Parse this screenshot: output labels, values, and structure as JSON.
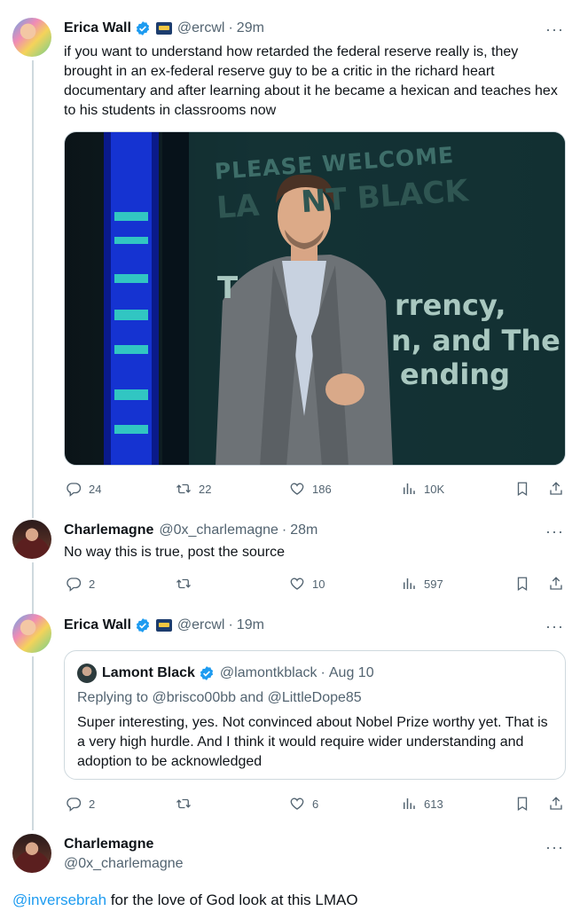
{
  "tweets": [
    {
      "name": "Erica Wall",
      "handle": "@ercwl",
      "time": "29m",
      "text": "if you want to understand how retarded the federal reserve really is, they brought in an ex-federal reserve guy to be a critic in the richard heart documentary and after learning about it he became a hexican and teaches hex to his students in classrooms now",
      "image": {
        "line1": "PLEASE WELCOME",
        "line2": "LA    NT BLACK",
        "line3": "rrency,",
        "line4": "n, and The",
        "line5": "ending",
        "line3_prefix": "T"
      },
      "stats": {
        "replies": "24",
        "retweets": "22",
        "likes": "186",
        "views": "10K"
      }
    },
    {
      "name": "Charlemagne",
      "handle": "@0x_charlemagne",
      "time": "28m",
      "text": "No way this is true, post the source",
      "stats": {
        "replies": "2",
        "retweets": "",
        "likes": "10",
        "views": "597"
      }
    },
    {
      "name": "Erica Wall",
      "handle": "@ercwl",
      "time": "19m",
      "quote": {
        "name": "Lamont Black",
        "handle": "@lamontkblack",
        "time": "Aug 10",
        "replying_prefix": "Replying to ",
        "replying_to_1": "@brisco00bb",
        "replying_and": " and ",
        "replying_to_2": "@LittleDope85",
        "text": "Super interesting, yes. Not convinced about Nobel Prize worthy yet. That is a very high hurdle. And I think it would require wider understanding and adoption to be acknowledged"
      },
      "stats": {
        "replies": "2",
        "retweets": "",
        "likes": "6",
        "views": "613"
      }
    },
    {
      "name": "Charlemagne",
      "handle": "@0x_charlemagne",
      "mention": "@inversebrah",
      "text": " for the love of God look at this LMAO"
    }
  ],
  "colors": {
    "accent": "#1d9bf0",
    "muted": "#536471",
    "border": "#cfd9de"
  },
  "icons": [
    "verified-badge-icon",
    "affiliate-badge-icon",
    "more-icon",
    "reply-icon",
    "retweet-icon",
    "like-icon",
    "views-icon",
    "bookmark-icon",
    "share-icon"
  ]
}
